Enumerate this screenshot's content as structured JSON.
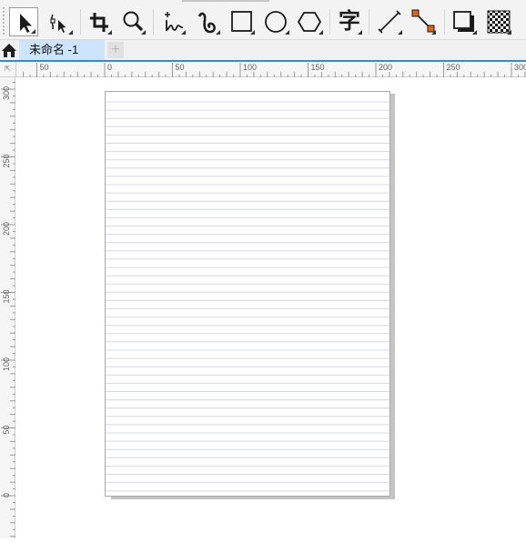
{
  "toolbar": {
    "tools": [
      {
        "name": "pick-tool",
        "icon": "arrow-pointer-icon",
        "active": true
      },
      {
        "name": "shape-edit-tool",
        "icon": "shape-node-icon"
      },
      {
        "name": "crop-tool",
        "icon": "crop-icon"
      },
      {
        "name": "zoom-tool",
        "icon": "magnifier-icon"
      },
      {
        "name": "freehand-tool",
        "icon": "freehand-curve-icon"
      },
      {
        "name": "artistic-media-tool",
        "icon": "brush-curve-icon"
      },
      {
        "name": "rectangle-tool",
        "icon": "rectangle-icon"
      },
      {
        "name": "ellipse-tool",
        "icon": "ellipse-icon"
      },
      {
        "name": "polygon-tool",
        "icon": "polygon-icon"
      },
      {
        "name": "text-tool",
        "icon": "text-char-icon",
        "glyph": "字"
      },
      {
        "name": "dimension-tool",
        "icon": "dimension-line-icon"
      },
      {
        "name": "connector-tool",
        "icon": "connector-icon"
      },
      {
        "name": "drop-shadow-tool",
        "icon": "drop-shadow-icon"
      },
      {
        "name": "transparency-tool",
        "icon": "checkerboard-icon"
      }
    ]
  },
  "tabs": {
    "home_icon": "home-icon",
    "document_tab": "未命名 -1",
    "add_tab": "+"
  },
  "rulers": {
    "corner_glyph": "⇱",
    "horizontal_labels": [
      "50",
      "0",
      "50",
      "100",
      "150",
      "200",
      "250",
      "300"
    ],
    "vertical_labels": [
      "300",
      "250",
      "200",
      "150",
      "100",
      "50",
      "0"
    ]
  },
  "colors": {
    "accent": "#2b8ed6",
    "active_tab": "#cde5fa",
    "connector_node": "#e8630a",
    "page_line": "#d4d8ec"
  }
}
